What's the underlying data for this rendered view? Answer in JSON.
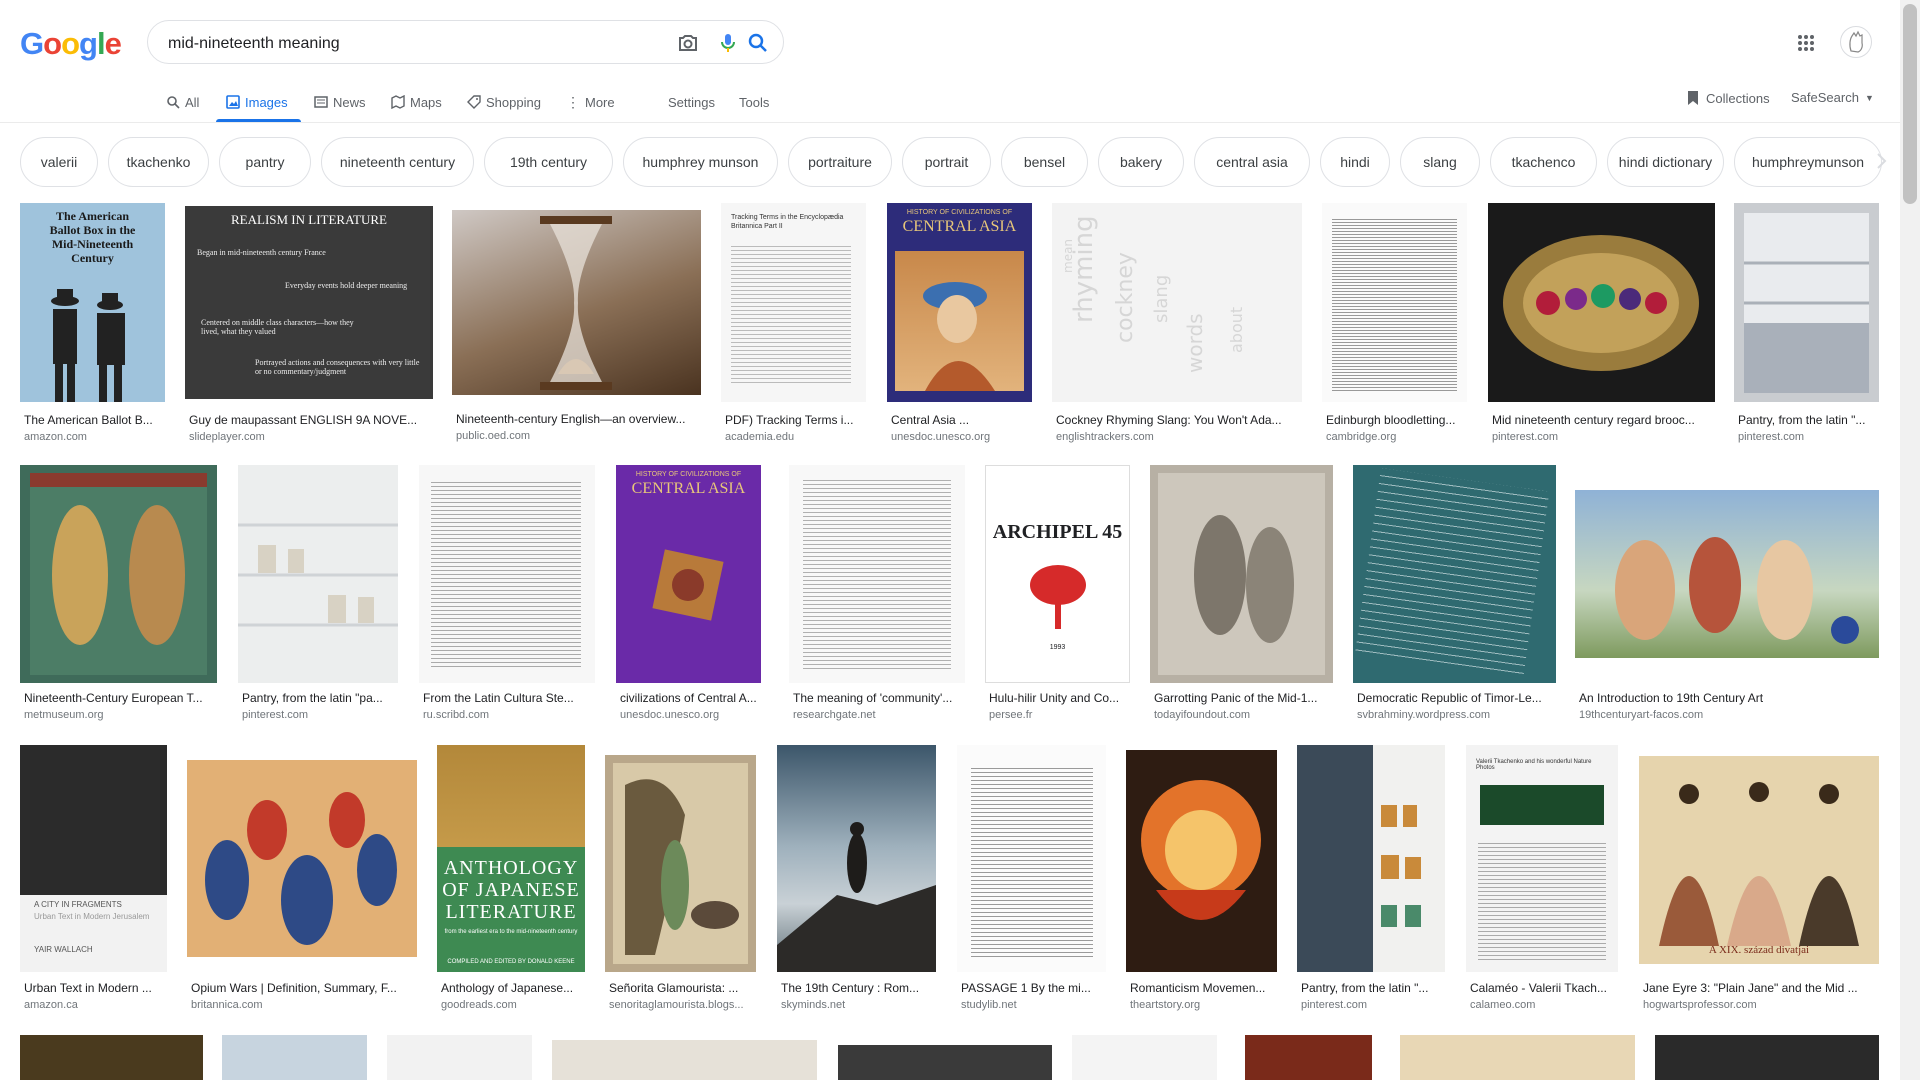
{
  "logo": {
    "letters": [
      "G",
      "o",
      "o",
      "g",
      "l",
      "e"
    ],
    "colors": [
      "#4285F4",
      "#EA4335",
      "#FBBC05",
      "#4285F4",
      "#34A853",
      "#EA4335"
    ]
  },
  "search": {
    "query": "mid-nineteenth meaning"
  },
  "tabs": [
    {
      "label": "All",
      "icon": "search-icon"
    },
    {
      "label": "Images",
      "icon": "image-icon",
      "active": true
    },
    {
      "label": "News",
      "icon": "news-icon"
    },
    {
      "label": "Maps",
      "icon": "map-icon"
    },
    {
      "label": "Shopping",
      "icon": "tag-icon"
    },
    {
      "label": "More",
      "icon": "more-vert-icon"
    },
    {
      "label": "Settings"
    },
    {
      "label": "Tools"
    }
  ],
  "header_right": {
    "collections": "Collections",
    "safesearch": "SafeSearch"
  },
  "chips": [
    "valerii",
    "tkachenko",
    "pantry",
    "nineteenth century",
    "19th century",
    "humphrey munson",
    "portraiture",
    "portrait",
    "bensel",
    "bakery",
    "central asia",
    "hindi",
    "slang",
    "tkachenco",
    "hindi dictionary",
    "humphreymunson"
  ],
  "results": [
    {
      "caption": "The American Ballot B...",
      "source": "amazon.com",
      "thumb_text": [
        "The American",
        "Ballot Box in the",
        "Mid-Nineteenth",
        "Century"
      ],
      "color": "#9fc3dc"
    },
    {
      "caption": "Guy de maupassant ENGLISH 9A NOVE...",
      "source": "slideplayer.com",
      "thumb_text": [
        "REALISM IN LITERATURE",
        "Began in mid-nineteenth century France",
        "Everyday events hold deeper meaning",
        "Centered on middle class characters—how they lived, what they valued",
        "Portrayed actions and consequences with very little or no commentary/judgment"
      ],
      "color": "#3a3a3a"
    },
    {
      "caption": "Nineteenth-century English—an overview...",
      "source": "public.oed.com",
      "color": "#6b4f36"
    },
    {
      "caption": "PDF) Tracking Terms i...",
      "source": "academia.edu",
      "thumb_text": [
        "Tracking Terms in the Encyclopædia Britannica Part II"
      ],
      "color": "#f6f6f6"
    },
    {
      "caption": "Central Asia ...",
      "source": "unesdoc.unesco.org",
      "thumb_text": [
        "HISTORY OF CIVILIZATIONS OF",
        "CENTRAL ASIA"
      ],
      "color": "#2d2c7a"
    },
    {
      "caption": "Cockney Rhyming Slang: You Won't Ada...",
      "source": "englishtrackers.com",
      "color": "#f3f3f3"
    },
    {
      "caption": "Edinburgh bloodletting...",
      "source": "cambridge.org",
      "color": "#fafafa"
    },
    {
      "caption": "Mid nineteenth century regard brooc...",
      "source": "pinterest.com",
      "color": "#1a1a1a"
    },
    {
      "caption": "Pantry, from the latin \"...",
      "source": "pinterest.com",
      "color": "#c9ccd0"
    },
    {
      "caption": "Nineteenth-Century European T...",
      "source": "metmuseum.org",
      "color": "#3f6b5a"
    },
    {
      "caption": "Pantry, from the latin \"pa...",
      "source": "pinterest.com",
      "color": "#eceeee"
    },
    {
      "caption": "From the Latin Cultura Ste...",
      "source": "ru.scribd.com",
      "color": "#f7f7f7"
    },
    {
      "caption": "civilizations of Central A...",
      "source": "unesdoc.unesco.org",
      "thumb_text": [
        "HISTORY OF CIVILIZATIONS OF",
        "CENTRAL ASIA"
      ],
      "color": "#6a2aa8"
    },
    {
      "caption": "The meaning of 'community'...",
      "source": "researchgate.net",
      "color": "#f8f8f8"
    },
    {
      "caption": "Hulu-hilir Unity and Co...",
      "source": "persee.fr",
      "thumb_text": [
        "ARCHIPEL 45",
        "1993"
      ],
      "color": "#ffffff"
    },
    {
      "caption": "Garrotting Panic of the Mid-1...",
      "source": "todayifoundout.com",
      "color": "#b7b0a4"
    },
    {
      "caption": "Democratic Republic of Timor-Le...",
      "source": "svbrahminy.wordpress.com",
      "color": "#2f6a70"
    },
    {
      "caption": "An Introduction to 19th Century Art",
      "source": "19thcenturyart-facos.com",
      "color": "#7aa0c8"
    },
    {
      "caption": "Urban Text in Modern ...",
      "source": "amazon.ca",
      "thumb_text": [
        "A CITY IN FRAGMENTS",
        "Urban Text in Modern Jerusalem",
        "YAIR WALLACH"
      ],
      "color": "#2b2b2b"
    },
    {
      "caption": "Opium Wars | Definition, Summary, F...",
      "source": "britannica.com",
      "color": "#b2622e"
    },
    {
      "caption": "Anthology of Japanese...",
      "source": "goodreads.com",
      "thumb_text": [
        "ANTHOLOGY",
        "OF JAPANESE",
        "LITERATURE",
        "from the earliest era to the mid-nineteenth century",
        "COMPILED AND EDITED BY DONALD KEENE"
      ],
      "color": "#3e8a52"
    },
    {
      "caption": "Señorita Glamourista: ...",
      "source": "senoritaglamourista.blogs...",
      "color": "#b9a78a"
    },
    {
      "caption": "The 19th Century : Rom...",
      "source": "skyminds.net",
      "color": "#4d6473"
    },
    {
      "caption": "PASSAGE 1 By the mi...",
      "source": "studylib.net",
      "color": "#fbfbfb"
    },
    {
      "caption": "Romanticism Movemen...",
      "source": "theartstory.org",
      "color": "#2e1c12"
    },
    {
      "caption": "Pantry, from the latin \"...",
      "source": "pinterest.com",
      "color": "#3b4a58"
    },
    {
      "caption": "Calaméo - Valerii Tkach...",
      "source": "calameo.com",
      "thumb_text": [
        "Valerii Tkachenko and his wonderful Nature Photos"
      ],
      "color": "#f3f3f3"
    },
    {
      "caption": "Jane Eyre 3: \"Plain Jane\" and the Mid ...",
      "source": "hogwartsprofessor.com",
      "thumb_text": [
        "A XIX. század divatjai"
      ],
      "color": "#e6d4ad"
    }
  ]
}
